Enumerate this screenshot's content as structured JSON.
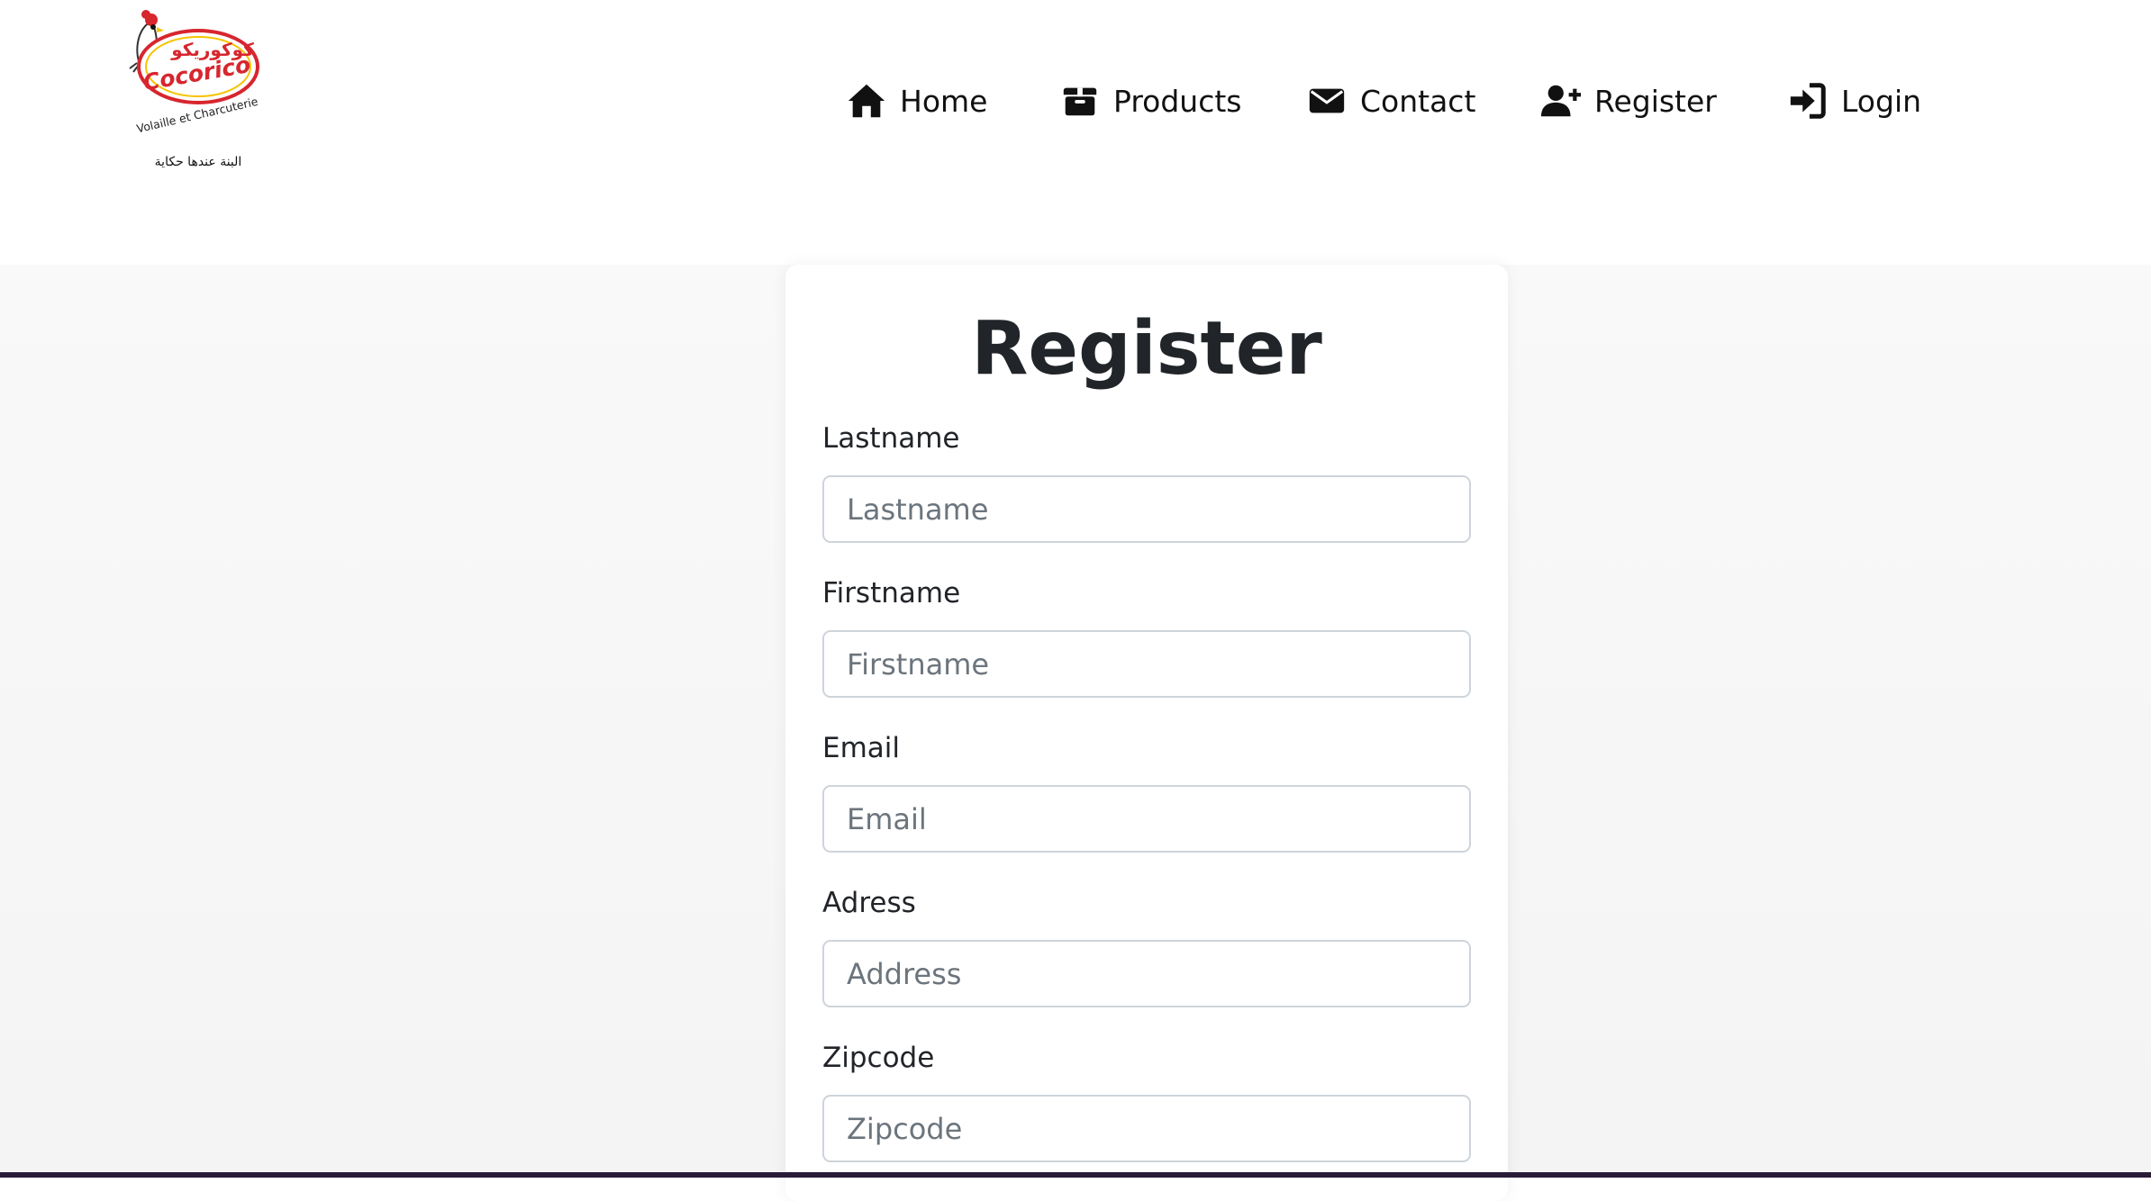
{
  "brand": {
    "name_arabic": "كوكوريكو",
    "name_latin": "Cocorico",
    "subtitle": "Volaille et Charcuterie",
    "tagline": "البنة عندها حكاية",
    "colors": {
      "red": "#d7262e",
      "yellow": "#f5c400"
    }
  },
  "nav": {
    "items": [
      {
        "label": "Home",
        "icon": "home-icon"
      },
      {
        "label": "Products",
        "icon": "box-icon"
      },
      {
        "label": "Contact",
        "icon": "envelope-icon"
      },
      {
        "label": "Register",
        "icon": "user-plus-icon"
      },
      {
        "label": "Login",
        "icon": "sign-in-icon"
      }
    ]
  },
  "form": {
    "title": "Register",
    "fields": [
      {
        "label": "Lastname",
        "placeholder": "Lastname",
        "value": ""
      },
      {
        "label": "Firstname",
        "placeholder": "Firstname",
        "value": ""
      },
      {
        "label": "Email",
        "placeholder": "Email",
        "value": ""
      },
      {
        "label": "Adress",
        "placeholder": "Address",
        "value": ""
      },
      {
        "label": "Zipcode",
        "placeholder": "Zipcode",
        "value": ""
      }
    ]
  },
  "colors": {
    "text": "#212529",
    "page_background": "#f7f7f7",
    "input_border": "#ced4da",
    "placeholder": "#6c757d",
    "bottom_bar": "#2a1b36"
  }
}
